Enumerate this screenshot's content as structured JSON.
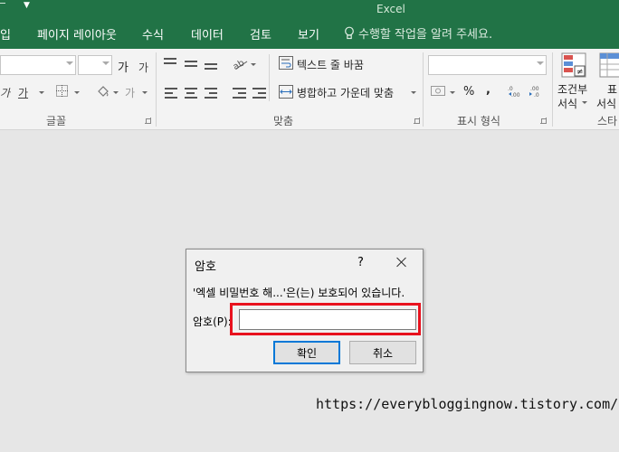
{
  "app": {
    "title": "Excel"
  },
  "tabs": [
    "입",
    "페이지 레이아웃",
    "수식",
    "데이터",
    "검토",
    "보기"
  ],
  "tell_me": "수행할 작업을 알려 주세요.",
  "ribbon": {
    "font_group": {
      "label": "글꼴",
      "grow_font": "가",
      "shrink_font": "가",
      "italic": "가",
      "underline": "가",
      "font_color": "가"
    },
    "alignment_group": {
      "label": "맞춤",
      "wrap_text": "텍스트 줄 바꿈",
      "merge_center": "병합하고 가운데 맞춤"
    },
    "number_group": {
      "label": "표시 형식",
      "percent": "%",
      "comma": ","
    },
    "styles_group": {
      "conditional_line1": "조건부",
      "conditional_line2": "서식",
      "table_line1": "표",
      "table_line2": "서식",
      "styles_label": "스타"
    }
  },
  "dialog": {
    "title": "암호",
    "help": "?",
    "message": "'엑셀 비밀번호 해...'은(는) 보호되어 있습니다.",
    "password_label": "암호(P):",
    "password_value": "",
    "ok": "확인",
    "cancel": "취소"
  },
  "watermark": "https://everybloggingnow.tistory.com/",
  "colors": {
    "ribbon_green": "#217346",
    "highlight_red": "#e8121e",
    "focus_blue": "#0078d7"
  }
}
